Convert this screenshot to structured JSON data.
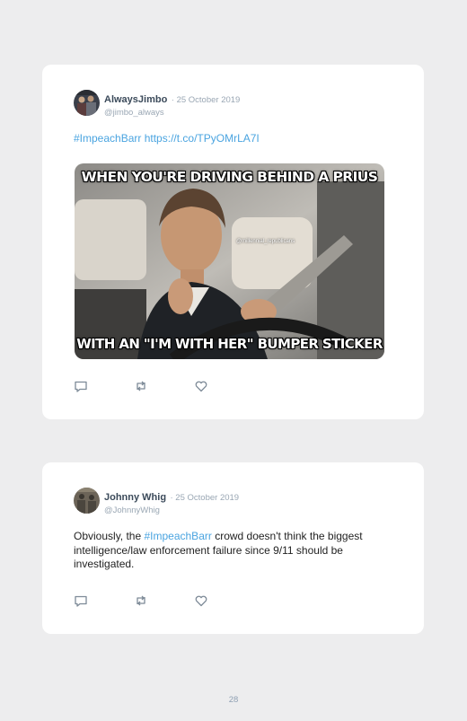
{
  "tweets": [
    {
      "name": "AlwaysJimbo",
      "date": "· 25 October 2019",
      "handle": "@jimbo_always",
      "hashtag": "#ImpeachBarr",
      "link": "https://t.co/TPyOMrLA7I",
      "meme": {
        "top_text": "WHEN YOU'RE DRIVING BEHIND A PRIUS",
        "bottom_text": "WITH AN \"I'M WITH HER\" BUMPER STICKER",
        "watermark": "@millennial_republicans"
      }
    },
    {
      "name": "Johnny Whig",
      "date": "· 25 October 2019",
      "handle": "@JohnnyWhig",
      "text_before": "Obviously, the ",
      "hashtag": "#ImpeachBarr",
      "text_after": " crowd doesn't think the biggest intelligence/law enforcement failure since 9/11 should be investigated."
    }
  ],
  "page_number": "28",
  "icons": {
    "reply": "reply-icon",
    "retweet": "retweet-icon",
    "like": "heart-icon"
  },
  "colors": {
    "link": "#4aa4e0",
    "name": "#3b4a5a",
    "muted": "#9aa7b4",
    "background": "#ededee"
  }
}
